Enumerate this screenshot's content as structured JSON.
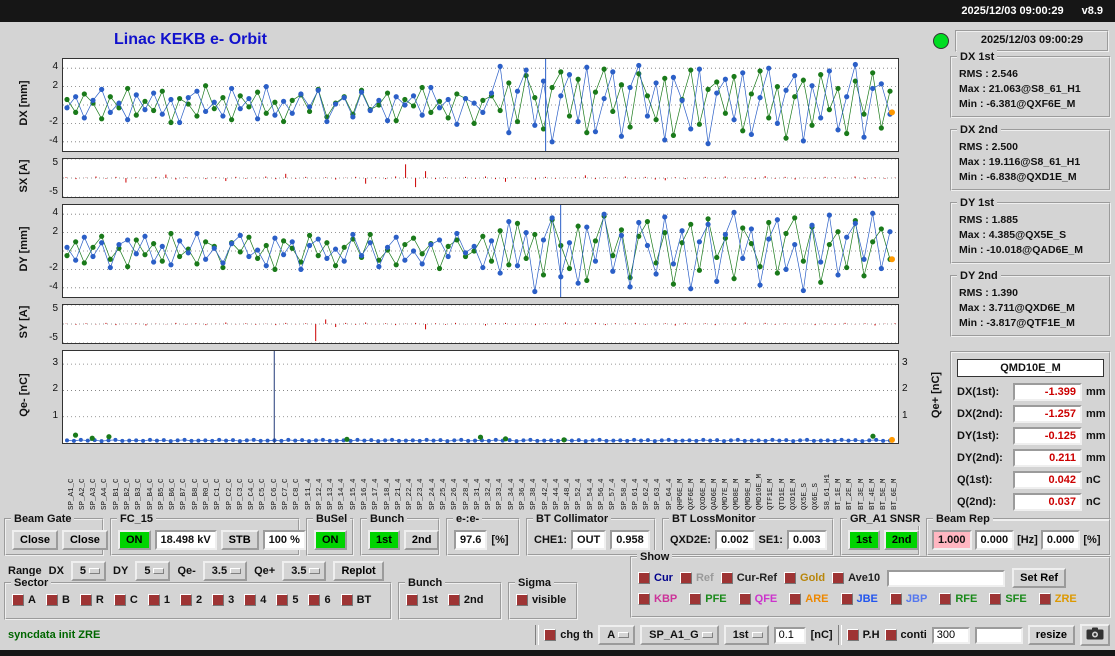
{
  "titlebar": {
    "datetime": "2025/12/03 09:00:29",
    "version": "v8.9"
  },
  "header": {
    "title": "Linac KEKB e- Orbit",
    "timestamp": "2025/12/03 09:00:29"
  },
  "stats": [
    {
      "title": "DX 1st",
      "lines": [
        "RMS : 2.546",
        "Max : 21.063@S8_61_H1",
        "Min : -6.381@QXF6E_M"
      ]
    },
    {
      "title": "DX 2nd",
      "lines": [
        "RMS : 2.500",
        "Max : 19.116@S8_61_H1",
        "Min : -6.838@QXD1E_M"
      ]
    },
    {
      "title": "DY 1st",
      "lines": [
        "RMS : 1.885",
        "Max : 4.385@QX5E_S",
        "Min : -10.018@QAD6E_M"
      ]
    },
    {
      "title": "DY 2nd",
      "lines": [
        "RMS : 1.390",
        "Max : 3.711@QXD6E_M",
        "Min : -3.817@QTF1E_M"
      ]
    }
  ],
  "monitor": {
    "title": "QMD10E_M",
    "rows": [
      {
        "label": "DX(1st):",
        "value": "-1.399",
        "unit": "mm"
      },
      {
        "label": "DX(2nd):",
        "value": "-1.257",
        "unit": "mm"
      },
      {
        "label": "DY(1st):",
        "value": "-0.125",
        "unit": "mm"
      },
      {
        "label": "DY(2nd):",
        "value": "0.211",
        "unit": "mm"
      },
      {
        "label": "Q(1st):",
        "value": "0.042",
        "unit": "nC"
      },
      {
        "label": "Q(2nd):",
        "value": "0.037",
        "unit": "nC"
      }
    ]
  },
  "beam_gate": {
    "title": "Beam Gate",
    "btn1": "Close",
    "btn2": "Close"
  },
  "fc15": {
    "title": "FC_15",
    "on": "ON",
    "kv": "18.498 kV",
    "stb": "STB",
    "pct": "100 %"
  },
  "busel": {
    "title": "BuSel",
    "on": "ON"
  },
  "bunch": {
    "title": "Bunch",
    "b1": "1st",
    "b2": "2nd"
  },
  "ee": {
    "title": "e-:e-",
    "value": "97.6",
    "unit": "[%]"
  },
  "bt_coll": {
    "title": "BT Collimator",
    "label": "CHE1:",
    "state": "OUT",
    "value": "0.958"
  },
  "bt_loss": {
    "title": "BT LossMonitor",
    "l1": "QXD2E:",
    "v1": "0.002",
    "l2": "SE1:",
    "v2": "0.003"
  },
  "gr_snsr": {
    "title": "GR_A1 SNSR",
    "b1": "1st",
    "b2": "2nd"
  },
  "beam_rep": {
    "title": "Beam Rep",
    "v1": "1.000",
    "v2": "0.000",
    "u1": "[Hz]",
    "v3": "0.000",
    "u2": "[%]"
  },
  "range_row": {
    "label": "Range",
    "dx_label": "DX",
    "dx": "5",
    "dy_label": "DY",
    "dy": "5",
    "qm_label": "Qe-",
    "qm": "3.5",
    "qp_label": "Qe+",
    "qp": "3.5",
    "replot": "Replot"
  },
  "sector": {
    "title": "Sector",
    "items": [
      "A",
      "B",
      "R",
      "C",
      "1",
      "2",
      "3",
      "4",
      "5",
      "6",
      "BT"
    ]
  },
  "bunch_sel": {
    "title": "Bunch",
    "items": [
      "1st",
      "2nd"
    ]
  },
  "sigma": {
    "title": "Sigma",
    "items": [
      "visible"
    ]
  },
  "show": {
    "title": "Show",
    "row1": [
      {
        "label": "Cur",
        "color": "#00008b"
      },
      {
        "label": "Ref",
        "color": "#9a9a9a"
      },
      {
        "label": "Cur-Ref",
        "color": "#222222"
      },
      {
        "label": "Gold",
        "color": "#b8860b"
      },
      {
        "label": "Ave10",
        "color": "#222222"
      }
    ],
    "ref_input": "",
    "set_ref": "Set Ref",
    "row2": [
      {
        "label": "KBP",
        "color": "#cc3399"
      },
      {
        "label": "PFE",
        "color": "#1a8a1a"
      },
      {
        "label": "QFE",
        "color": "#cc33cc"
      },
      {
        "label": "ARE",
        "color": "#ee8800"
      },
      {
        "label": "JBE",
        "color": "#2255ee"
      },
      {
        "label": "JBP",
        "color": "#5577ee"
      },
      {
        "label": "RFE",
        "color": "#1a8a1a"
      },
      {
        "label": "SFE",
        "color": "#1a8a1a"
      },
      {
        "label": "ZRE",
        "color": "#dd9900"
      }
    ]
  },
  "statusline": "syncdata init ZRE",
  "bottom": {
    "chg_th": "chg th",
    "mode": "A",
    "monitor_sel": "SP_A1_G",
    "bunch_sel": "1st",
    "threshold": "0.1",
    "unit": "[nC]",
    "ph": "P.H",
    "conti": "conti",
    "num": "300",
    "num2": "",
    "resize": "resize"
  },
  "colors": {
    "accent_green": "#00d400",
    "lamp": "#00dd22",
    "plot_blue": "#2b5fc7",
    "plot_green": "#1a7a1a",
    "plot_red": "#cc0000",
    "plot_orange": "#ff9900",
    "value_red": "#cc0000",
    "pink": "#ffb6c1"
  },
  "chart_data": [
    {
      "id": "dx",
      "type": "scatter",
      "ylabel": "DX [mm]",
      "ylim": [
        -5,
        5
      ],
      "yticks": [
        4,
        2,
        -2,
        -4
      ],
      "spike_frac": 0.578,
      "end_dot": {
        "color": "#ff9900",
        "value": -0.8
      },
      "series": [
        {
          "name": "2nd bunch",
          "color": "#1a7a1a",
          "values": [
            0.6,
            -0.8,
            1.2,
            0.2,
            -1.5,
            0.9,
            -0.3,
            1.8,
            -1.1,
            0.4,
            -0.6,
            1.5,
            -1.9,
            0.7,
            0.1,
            -1.2,
            2.1,
            -0.4,
            0.8,
            -1.6,
            1.0,
            -0.2,
            1.4,
            -0.9,
            0.3,
            -1.8,
            0.5,
            1.1,
            -0.7,
            1.7,
            -1.3,
            0.2,
            0.9,
            -1.0,
            1.6,
            -0.5,
            0.0,
            1.3,
            -1.7,
            0.6,
            -0.1,
            1.9,
            -0.8,
            0.4,
            -1.4,
            1.2,
            0.7,
            -2.0,
            0.5,
            1.0,
            -0.6,
            2.4,
            -1.8,
            3.2,
            0.8,
            -2.6,
            1.9,
            3.6,
            -1.2,
            2.8,
            -3.0,
            1.4,
            3.9,
            -0.7,
            2.2,
            -2.4,
            3.4,
            1.0,
            -1.6,
            2.9,
            -3.3,
            0.6,
            3.8,
            -2.1,
            1.7,
            2.5,
            -0.9,
            3.1,
            -2.8,
            1.2,
            3.7,
            -1.4,
            2.0,
            -3.6,
            0.9,
            2.7,
            -2.2,
            3.3,
            -0.5,
            1.8,
            -3.1,
            2.6,
            -1.0,
            3.5,
            -2.5,
            1.5
          ]
        },
        {
          "name": "1st bunch",
          "color": "#2b5fc7",
          "values": [
            -0.3,
            0.9,
            -1.4,
            0.5,
            1.7,
            -0.8,
            0.2,
            -1.6,
            1.1,
            -0.5,
            1.3,
            -1.0,
            0.6,
            -1.9,
            0.8,
            1.5,
            -0.7,
            0.3,
            -1.2,
            1.8,
            -0.4,
            0.7,
            -1.5,
            2.0,
            -1.1,
            0.4,
            -0.9,
            1.2,
            -0.2,
            1.6,
            -1.8,
            0.1,
            0.8,
            -1.3,
            1.4,
            -0.6,
            0.5,
            -1.7,
            0.9,
            0.0,
            1.0,
            -1.1,
            1.9,
            -0.3,
            0.6,
            -2.1,
            0.7,
            0.2,
            -0.8,
            1.3,
            4.2,
            -3.0,
            1.5,
            3.8,
            -2.2,
            2.6,
            -4.0,
            1.0,
            3.3,
            -1.8,
            4.1,
            -2.9,
            0.7,
            3.6,
            -3.4,
            1.9,
            4.3,
            -1.2,
            2.4,
            -3.8,
            3.0,
            0.5,
            -2.6,
            3.9,
            -4.2,
            1.3,
            2.8,
            -1.6,
            3.5,
            -3.2,
            0.8,
            4.0,
            -2.0,
            1.6,
            3.2,
            -3.9,
            2.1,
            -1.4,
            3.7,
            -2.7,
            0.9,
            4.4,
            -3.5,
            1.8,
            2.3,
            -1.0
          ]
        }
      ]
    },
    {
      "id": "sx",
      "type": "stem",
      "ylabel": "SX [A]",
      "ylim": [
        -5,
        5
      ],
      "yticks": [
        5,
        -5
      ],
      "color": "#cc0000",
      "values": [
        0.2,
        -0.3,
        0.1,
        0.4,
        -0.2,
        0.3,
        -1.2,
        0.2,
        -0.1,
        0.3,
        0.9,
        -0.4,
        0.2,
        0.1,
        -0.3,
        0.2,
        -0.8,
        0.3,
        -0.2,
        0.1,
        0.4,
        -0.3,
        1.1,
        -0.2,
        0.3,
        -0.1,
        0.2,
        -0.4,
        0.1,
        0.3,
        -1.5,
        0.2,
        -0.3,
        0.4,
        3.6,
        -2.4,
        1.8,
        -0.3,
        0.2,
        -0.1,
        0.3,
        -0.2,
        0.4,
        -0.3,
        -1.0,
        0.2,
        0.1,
        -0.4,
        0.3,
        -0.2,
        0.1,
        0.2,
        0.7,
        -0.3,
        0.2,
        -0.1,
        0.4,
        -0.2,
        0.3,
        -0.4,
        -0.6,
        0.2,
        -0.3,
        0.1,
        0.3,
        -0.2,
        0.4,
        -0.1,
        0.2,
        -0.3,
        0.5,
        -0.2,
        0.3,
        -0.4,
        0.1,
        -0.2,
        0.3,
        0.2,
        -0.1,
        0.4,
        -0.3,
        0.2,
        -0.2,
        0.1
      ]
    },
    {
      "id": "dy",
      "type": "scatter",
      "ylabel": "DY [mm]",
      "ylim": [
        -5,
        5
      ],
      "yticks": [
        4,
        2,
        -2,
        -4
      ],
      "spike_frac": 0.596,
      "end_dot": {
        "color": "#ff9900",
        "value": -0.9
      },
      "series": [
        {
          "name": "2nd bunch",
          "color": "#1a7a1a",
          "values": [
            -0.5,
            1.0,
            -1.3,
            0.4,
            1.6,
            -0.9,
            0.3,
            -1.7,
            1.2,
            -0.4,
            0.8,
            -1.1,
            1.9,
            -0.6,
            0.2,
            -1.4,
            1.0,
            0.5,
            -1.8,
            0.9,
            -0.1,
            1.5,
            -0.8,
            0.6,
            -2.0,
            1.1,
            0.3,
            -1.2,
            1.7,
            -0.5,
            0.9,
            -1.6,
            0.4,
            1.3,
            -0.7,
            1.8,
            -1.0,
            0.1,
            -1.5,
            0.7,
            1.4,
            -0.3,
            0.8,
            -1.9,
            0.5,
            1.2,
            -0.6,
            0.0,
            1.6,
            -1.1,
            2.2,
            -1.5,
            3.0,
            -0.8,
            1.8,
            -2.6,
            3.4,
            0.6,
            -1.9,
            2.7,
            -3.2,
            1.1,
            3.8,
            -0.5,
            2.3,
            -2.9,
            1.6,
            3.2,
            -1.3,
            2.0,
            -3.6,
            0.9,
            2.9,
            -2.1,
            3.5,
            -0.7,
            1.4,
            -3.0,
            2.5,
            0.8,
            -1.7,
            3.1,
            -2.4,
            1.9,
            3.6,
            -1.1,
            2.6,
            -3.4,
            0.7,
            2.1,
            -1.8,
            3.3,
            -2.7,
            1.0,
            2.4,
            -0.9
          ]
        },
        {
          "name": "1st bunch",
          "color": "#2b5fc7",
          "values": [
            0.4,
            -1.0,
            1.5,
            -0.6,
            0.9,
            -1.8,
            0.7,
            1.2,
            -0.3,
            1.6,
            -1.2,
            0.5,
            -1.5,
            1.1,
            -0.2,
            1.9,
            -0.9,
            0.3,
            -1.3,
            0.8,
            1.7,
            -0.6,
            0.1,
            -1.6,
            1.4,
            -0.4,
            1.0,
            -2.0,
            0.6,
            1.3,
            -0.8,
            0.2,
            -1.1,
            1.8,
            -0.5,
            0.9,
            -1.7,
            0.4,
            1.5,
            -1.0,
            0.0,
            -1.4,
            0.7,
            1.2,
            -0.6,
            1.9,
            -0.2,
            0.5,
            -1.8,
            1.1,
            -2.4,
            3.2,
            -1.6,
            2.0,
            -4.4,
            1.2,
            3.6,
            -2.8,
            0.9,
            -3.5,
            2.6,
            -1.1,
            4.0,
            -2.2,
            1.7,
            -3.9,
            3.1,
            0.6,
            -2.5,
            3.7,
            -1.4,
            2.2,
            -4.1,
            1.0,
            2.9,
            -3.3,
            1.8,
            4.2,
            -0.8,
            2.4,
            -3.7,
            1.3,
            3.4,
            -2.0,
            0.7,
            -4.3,
            2.8,
            -1.2,
            3.9,
            -2.6,
            1.5,
            3.0,
            -0.9,
            4.1,
            -1.9,
            2.1
          ]
        }
      ]
    },
    {
      "id": "sy",
      "type": "stem",
      "ylabel": "SY [A]",
      "ylim": [
        -5,
        5
      ],
      "yticks": [
        5,
        -5
      ],
      "color": "#cc0000",
      "values": [
        0.1,
        -0.2,
        0.2,
        -0.1,
        0.3,
        -0.3,
        0.1,
        0.2,
        -0.4,
        0.1,
        -0.1,
        0.3,
        -0.2,
        0.2,
        -0.3,
        0.1,
        0.4,
        -0.1,
        0.2,
        -0.2,
        0.1,
        -0.3,
        0.3,
        -0.1,
        0.2,
        -4.5,
        1.2,
        -0.8,
        0.3,
        -0.2,
        0.4,
        -0.1,
        0.2,
        -0.3,
        0.1,
        0.3,
        -1.4,
        0.2,
        -0.2,
        0.3,
        -0.1,
        0.1,
        -0.4,
        0.2,
        0.3,
        -0.2,
        0.1,
        -0.3,
        0.2,
        -0.1,
        0.4,
        -0.2,
        0.1,
        0.3,
        -0.3,
        0.2,
        -0.1,
        0.3,
        -0.2,
        0.1,
        0.2,
        -0.4,
        0.3,
        -0.1,
        0.2,
        -0.3,
        0.1,
        -0.2,
        0.4,
        -0.1,
        0.3,
        -0.2,
        0.2,
        -0.1,
        0.1,
        -0.3,
        0.2,
        -0.2,
        0.3,
        -0.1,
        0.2,
        -0.4,
        0.1,
        0.2
      ]
    },
    {
      "id": "q",
      "type": "scatter",
      "ylabel": "Qe- [nC]",
      "ylabel_right": "Qe+ [nC]",
      "ylim": [
        0,
        3.5
      ],
      "yticks": [
        3,
        2,
        1
      ],
      "yticks_right": [
        3,
        2,
        1
      ],
      "dot_r": 2,
      "spike_frac": 0.253,
      "spike_color": "#223a7a",
      "end_dot": {
        "color": "#ff9900",
        "value": 0.12
      },
      "green_points": [
        [
          0.015,
          0.3
        ],
        [
          0.035,
          0.18
        ],
        [
          0.055,
          0.24
        ],
        [
          0.34,
          0.14
        ],
        [
          0.5,
          0.22
        ],
        [
          0.53,
          0.16
        ],
        [
          0.6,
          0.12
        ],
        [
          0.97,
          0.26
        ]
      ],
      "series": [
        {
          "name": "Qe-",
          "color": "#2b5fc7",
          "values": [
            0.1,
            0.08,
            0.12,
            0.09,
            0.11,
            0.07,
            0.1,
            0.12,
            0.08,
            0.09,
            0.1,
            0.08,
            0.12,
            0.09,
            0.11,
            0.07,
            0.1,
            0.12,
            0.08,
            0.09,
            0.1,
            0.08,
            0.12,
            0.09,
            0.11,
            0.07,
            0.1,
            0.12,
            0.08,
            0.09,
            0.1,
            0.08,
            0.12,
            0.09,
            0.11,
            0.07,
            0.1,
            0.12,
            0.08,
            0.09,
            0.1,
            0.08,
            0.12,
            0.09,
            0.11,
            0.07,
            0.1,
            0.12,
            0.08,
            0.09,
            0.1,
            0.08,
            0.12,
            0.09,
            0.11,
            0.07,
            0.1,
            0.12,
            0.08,
            0.09,
            0.1,
            0.08,
            0.12,
            0.09,
            0.11,
            0.07,
            0.1,
            0.12,
            0.08,
            0.09,
            0.1,
            0.08,
            0.12,
            0.09,
            0.11,
            0.07,
            0.1,
            0.12,
            0.08,
            0.09,
            0.1,
            0.08,
            0.12,
            0.09,
            0.11,
            0.07,
            0.1,
            0.12,
            0.08,
            0.09,
            0.1,
            0.08,
            0.12,
            0.09,
            0.11,
            0.07,
            0.1,
            0.12,
            0.08,
            0.09,
            0.1,
            0.08,
            0.12,
            0.09,
            0.11,
            0.07,
            0.1,
            0.12,
            0.08,
            0.09,
            0.1,
            0.08,
            0.12,
            0.09,
            0.11,
            0.07,
            0.1,
            0.12,
            0.08,
            0.09
          ]
        }
      ]
    }
  ],
  "xlabels": [
    "SP_A1_C",
    "SP_A2_C",
    "SP_A3_C",
    "SP_A4_C",
    "SP_B1_C",
    "SP_B2_C",
    "SP_B3_C",
    "SP_B4_C",
    "SP_B5_C",
    "SP_B6_C",
    "SP_B7_C",
    "SP_B8_C",
    "SP_R0_C",
    "SP_C1_C",
    "SP_C2_C",
    "SP_C3_C",
    "SP_C4_C",
    "SP_C5_C",
    "SP_C6_C",
    "SP_C7_C",
    "SP_C8_C",
    "SP_11_4",
    "SP_12_4",
    "SP_13_4",
    "SP_14_4",
    "SP_15_4",
    "SP_16_4",
    "SP_17_4",
    "SP_18_4",
    "SP_21_4",
    "SP_22_4",
    "SP_23_4",
    "SP_24_4",
    "SP_25_4",
    "SP_26_4",
    "SP_28_4",
    "SP_31_4",
    "SP_32_4",
    "SP_33_4",
    "SP_34_4",
    "SP_36_4",
    "SP_38_4",
    "SP_42_4",
    "SP_44_4",
    "SP_48_4",
    "SP_52_4",
    "SP_54_4",
    "SP_56_4",
    "SP_57_4",
    "SP_58_4",
    "SP_61_4",
    "SP_62_4",
    "SP_63_4",
    "SP_64_4",
    "QHP6E_M",
    "QXF6E_M",
    "QXD6E_M",
    "QAD6E_M",
    "QMD7E_M",
    "QMD8E_M",
    "QMD9E_M",
    "QMD10E_M",
    "QTF1E_M",
    "QTD1E_M",
    "QXD1E_M",
    "QX5E_S",
    "QX6E_S",
    "S8_61_H1",
    "BT_1E_M",
    "BT_2E_M",
    "BT_3E_M",
    "BT_4E_M",
    "BT_5E_M",
    "BT_6E_M"
  ]
}
